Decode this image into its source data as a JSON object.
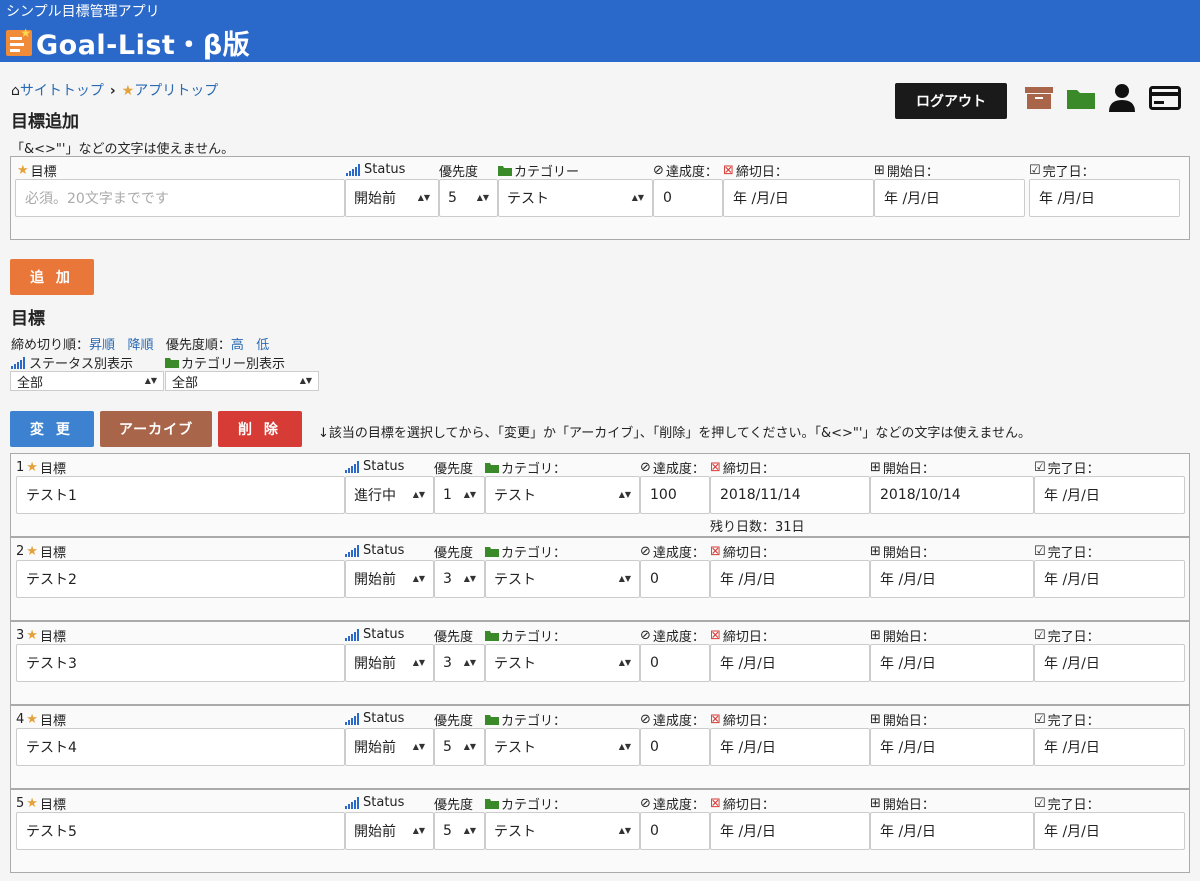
{
  "header": {
    "subtitle": "シンプル目標管理アプリ",
    "title": "Goal-List・β版"
  },
  "breadcrumb": {
    "site_top": "サイトトップ",
    "app_top": "アプリトップ"
  },
  "logout_label": "ログアウト",
  "add_section": {
    "title": "目標追加",
    "note": "「&<>\"'」などの文字は使えません。",
    "labels": {
      "goal": "目標",
      "status": "Status",
      "priority": "優先度",
      "category": "カテゴリー",
      "progress": "達成度：",
      "deadline": "締切日：",
      "start": "開始日：",
      "done": "完了日："
    },
    "goal_placeholder": "必須。20文字までです",
    "status": "開始前",
    "priority": "5",
    "category": "テスト",
    "progress": "0",
    "deadline": "年 /月/日",
    "start": "年 /月/日",
    "done": "年 /月/日",
    "add_button": "追 加"
  },
  "list_section": {
    "title": "目標",
    "sort_deadline_label": "締め切り順：",
    "asc": "昇順",
    "desc": "降順",
    "sort_priority_label": "優先度順：",
    "high": "高",
    "low": "低",
    "status_filter_label": "ステータス別表示",
    "category_filter_label": "カテゴリー別表示",
    "status_filter_value": "全部",
    "category_filter_value": "全部",
    "change_button": "変 更",
    "archive_button": "アーカイブ",
    "delete_button": "削 除",
    "instruction": "↓該当の目標を選択してから、「変更」か「アーカイブ」、「削除」を押してください。「&<>\"'」などの文字は使えません。",
    "labels": {
      "goal": "目標",
      "status": "Status",
      "priority": "優先度",
      "category": "カテゴリ：",
      "progress": "達成度：",
      "deadline": "締切日：",
      "start": "開始日：",
      "done": "完了日："
    }
  },
  "goals": [
    {
      "num": "1",
      "name": "テスト1",
      "status": "進行中",
      "priority": "1",
      "category": "テスト",
      "progress": "100",
      "deadline": "2018/11/14",
      "start": "2018/10/14",
      "done": "年 /月/日",
      "remaining": "残り日数：31日"
    },
    {
      "num": "2",
      "name": "テスト2",
      "status": "開始前",
      "priority": "3",
      "category": "テスト",
      "progress": "0",
      "deadline": "年 /月/日",
      "start": "年 /月/日",
      "done": "年 /月/日",
      "remaining": ""
    },
    {
      "num": "3",
      "name": "テスト3",
      "status": "開始前",
      "priority": "3",
      "category": "テスト",
      "progress": "0",
      "deadline": "年 /月/日",
      "start": "年 /月/日",
      "done": "年 /月/日",
      "remaining": ""
    },
    {
      "num": "4",
      "name": "テスト4",
      "status": "開始前",
      "priority": "5",
      "category": "テスト",
      "progress": "0",
      "deadline": "年 /月/日",
      "start": "年 /月/日",
      "done": "年 /月/日",
      "remaining": ""
    },
    {
      "num": "5",
      "name": "テスト5",
      "status": "開始前",
      "priority": "5",
      "category": "テスト",
      "progress": "0",
      "deadline": "年 /月/日",
      "start": "年 /月/日",
      "done": "年 /月/日",
      "remaining": ""
    }
  ],
  "colors": {
    "header": "#2a68c9",
    "add_button": "#e9773a",
    "change_button": "#3c82d1",
    "archive_button": "#a8654a",
    "delete_button": "#d63b35",
    "star": "#e3a23b",
    "folder": "#3a8a2a"
  },
  "icons": [
    "home-icon",
    "star-icon",
    "signal-icon",
    "folder-icon",
    "check-circle-icon",
    "calendar-x-icon",
    "calendar-plus-icon",
    "calendar-check-icon",
    "archive-box-icon",
    "user-icon",
    "card-icon"
  ]
}
